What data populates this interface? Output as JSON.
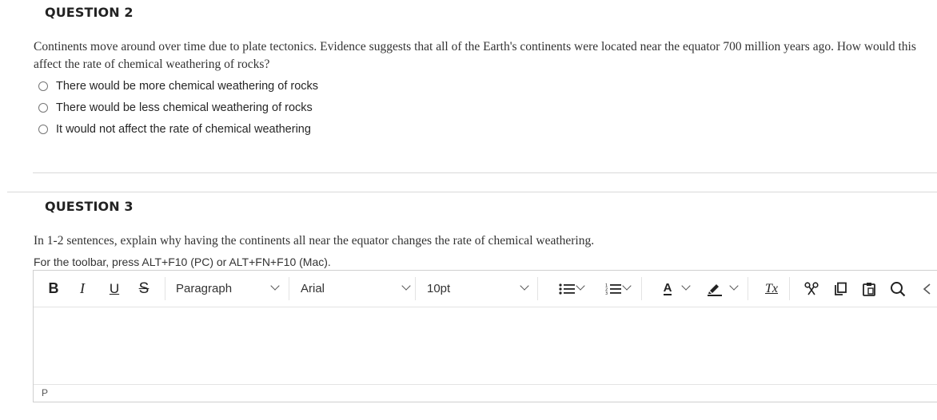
{
  "question2": {
    "title": "QUESTION 2",
    "text": "Continents move around over time due to plate tectonics.  Evidence suggests that all of the Earth's continents were located near the equator 700 million years ago.  How would this affect the rate of chemical weathering of rocks?",
    "options": [
      "There would be more chemical weathering of rocks",
      "There would be less chemical weathering of rocks",
      "It would not affect the rate of chemical weathering"
    ]
  },
  "question3": {
    "title": "QUESTION 3",
    "text": "In 1-2 sentences, explain why  having the continents all near the equator changes the rate of chemical weathering.",
    "hint": "For the toolbar, press ALT+F10 (PC) or ALT+FN+F10 (Mac)."
  },
  "toolbar": {
    "bold": "B",
    "italic": "I",
    "underline": "U",
    "strike": "S",
    "paragraph": "Paragraph",
    "font": "Arial",
    "size": "10pt",
    "text_color_letter": "A",
    "clear_format": "Tx"
  },
  "statusbar": {
    "path": "P"
  }
}
